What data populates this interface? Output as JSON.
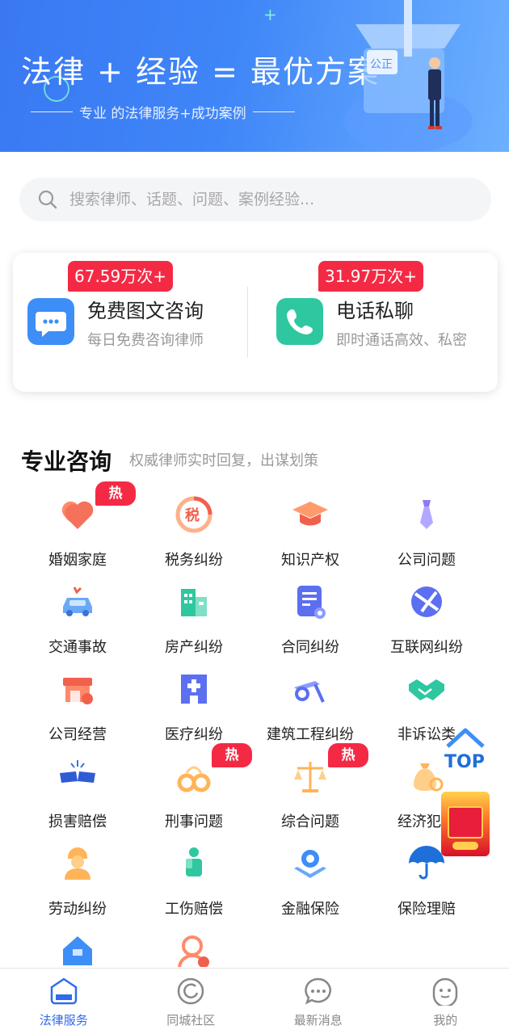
{
  "banner": {
    "title": "法律 + 经验 = 最优方案",
    "subtitle": "专业 的法律服务+成功案例",
    "art_sign": "公正"
  },
  "search": {
    "placeholder": "搜索律师、话题、问题、案例经验..."
  },
  "consult": [
    {
      "count": "67.59万次+",
      "title": "免费图文咨询",
      "desc": "每日免费咨询律师",
      "icon": "chat-icon",
      "color": "#3e8ef7"
    },
    {
      "count": "31.97万次+",
      "title": "电话私聊",
      "desc": "即时通话高效、私密",
      "icon": "phone-icon",
      "color": "#2fc7a0"
    }
  ],
  "section": {
    "title": "专业咨询",
    "subtitle": "权威律师实时回复，出谋划策"
  },
  "hot_label": "热门",
  "categories": [
    {
      "label": "婚姻家庭",
      "icon": "heart-icon",
      "hot": true
    },
    {
      "label": "税务纠纷",
      "icon": "tax-icon",
      "hot": false
    },
    {
      "label": "知识产权",
      "icon": "graduation-cap-icon",
      "hot": false
    },
    {
      "label": "公司问题",
      "icon": "tie-icon",
      "hot": false
    },
    {
      "label": "交通事故",
      "icon": "car-crash-icon",
      "hot": false
    },
    {
      "label": "房产纠纷",
      "icon": "building-icon",
      "hot": false
    },
    {
      "label": "合同纠纷",
      "icon": "contract-icon",
      "hot": false
    },
    {
      "label": "互联网纠纷",
      "icon": "globe-icon",
      "hot": false
    },
    {
      "label": "公司经营",
      "icon": "shop-icon",
      "hot": false
    },
    {
      "label": "医疗纠纷",
      "icon": "hospital-icon",
      "hot": false
    },
    {
      "label": "建筑工程纠纷",
      "icon": "construction-icon",
      "hot": false
    },
    {
      "label": "非诉讼类",
      "icon": "handshake-icon",
      "hot": false
    },
    {
      "label": "损害赔偿",
      "icon": "broken-icon",
      "hot": false
    },
    {
      "label": "刑事问题",
      "icon": "handcuffs-icon",
      "hot": true
    },
    {
      "label": "综合问题",
      "icon": "scales-icon",
      "hot": true
    },
    {
      "label": "经济犯罪",
      "icon": "money-bag-icon",
      "hot": false
    },
    {
      "label": "劳动纠纷",
      "icon": "worker-icon",
      "hot": false
    },
    {
      "label": "工伤赔偿",
      "icon": "injury-icon",
      "hot": false
    },
    {
      "label": "金融保险",
      "icon": "finance-icon",
      "hot": false
    },
    {
      "label": "保险理赔",
      "icon": "umbrella-icon",
      "hot": false
    },
    {
      "label": "",
      "icon": "house-icon",
      "hot": false
    },
    {
      "label": "",
      "icon": "person-icon",
      "hot": false
    }
  ],
  "floating": {
    "top_label": "TOP"
  },
  "nav": [
    {
      "label": "法律服务",
      "icon": "law-service-icon",
      "active": true
    },
    {
      "label": "同城社区",
      "icon": "community-icon",
      "active": false
    },
    {
      "label": "最新消息",
      "icon": "message-icon",
      "active": false
    },
    {
      "label": "我的",
      "icon": "profile-icon",
      "active": false
    }
  ],
  "colors": {
    "accent": "#2f6bea",
    "badge": "#f42a45",
    "banner": "#3f86f8"
  }
}
